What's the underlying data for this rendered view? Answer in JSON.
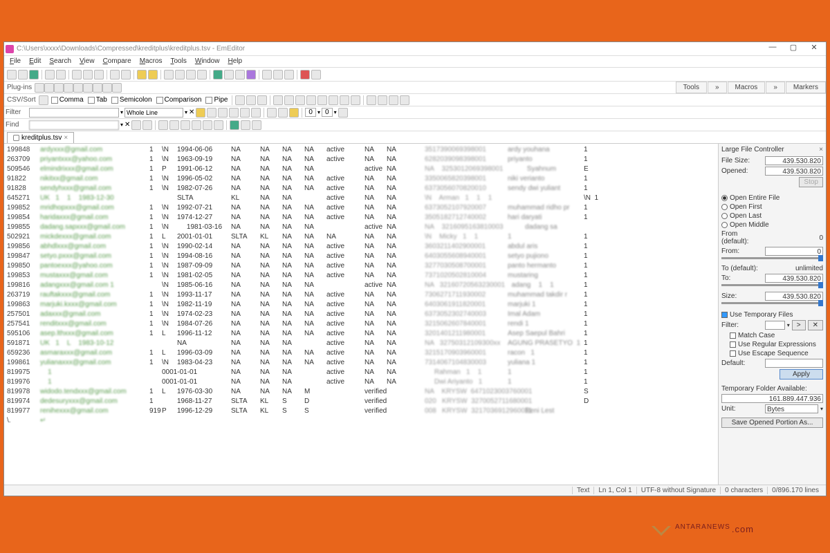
{
  "window": {
    "title": "C:\\Users\\xxxx\\Downloads\\Compressed\\kreditplus\\kreditplus.tsv - EmEditor",
    "min": "—",
    "max": "▢",
    "close": "✕"
  },
  "menu": {
    "file": "File",
    "edit": "Edit",
    "search": "Search",
    "view": "View",
    "compare": "Compare",
    "macros": "Macros",
    "tools": "Tools",
    "window": "Window",
    "help": "Help"
  },
  "plugins": {
    "label": "Plug-ins"
  },
  "sidetabs": {
    "tools": "Tools",
    "macros": "Macros",
    "markers": "Markers",
    "arrow": "»"
  },
  "csvbar": {
    "label": "CSV/Sort",
    "comma": "Comma",
    "tab": "Tab",
    "semicolon": "Semicolon",
    "comparison": "Comparison",
    "pipe": "Pipe"
  },
  "filter": {
    "label": "Filter",
    "mode": "Whole Line",
    "x": "✕"
  },
  "find": {
    "label": "Find"
  },
  "tab": {
    "name": "kreditplus.tsv",
    "close": "×"
  },
  "lfc": {
    "title": "Large File Controller",
    "x": "×",
    "filesize_lbl": "File Size:",
    "filesize": "439.530.820",
    "opened_lbl": "Opened:",
    "opened": "439.530.820",
    "stop": "Stop",
    "open_entire": "Open Entire File",
    "open_first": "Open First",
    "open_last": "Open Last",
    "open_middle": "Open Middle",
    "from_def_lbl": "From (default):",
    "from_def": "0",
    "from_lbl": "From:",
    "from": "0",
    "to_def_lbl": "To (default):",
    "to_def": "unlimited",
    "to_lbl": "To:",
    "to": "439.530.820",
    "size_lbl": "Size:",
    "size": "439.530.820",
    "use_temp": "Use Temporary Files",
    "filter_lbl": "Filter:",
    "match_case": "Match Case",
    "use_regex": "Use Regular Expressions",
    "use_esc": "Use Escape Sequence",
    "default_lbl": "Default:",
    "apply": "Apply",
    "tmp_avail_lbl": "Temporary Folder Available:",
    "tmp_avail": "161.889.447.936",
    "unit_lbl": "Unit:",
    "unit": "Bytes",
    "save_portion": "Save Opened Portion As..."
  },
  "status": {
    "mode": "Text",
    "pos": "Ln 1, Col 1",
    "enc": "UTF-8 without Signature",
    "chars": "0 characters",
    "lines": "0/896.170 lines"
  },
  "watermark": {
    "brand": "ANTARANEWS",
    "suffix": ".com"
  },
  "rows": [
    {
      "id": "199848",
      "em": "ardyxxx@gmail.com",
      "a": "1",
      "b": "\\N",
      "dt": "1994-06-06",
      "e": "NA",
      "f": "NA",
      "g": "NA",
      "h": "NA",
      "st": "active",
      "j": "NA",
      "k": "NA",
      "l": "3517390069398001",
      "nm": "ardy youhana",
      "n": "1"
    },
    {
      "id": "263709",
      "em": "priyantxxx@yahoo.com",
      "a": "1",
      "b": "\\N",
      "dt": "1963-09-19",
      "e": "NA",
      "f": "NA",
      "g": "NA",
      "h": "NA",
      "st": "active",
      "j": "NA",
      "k": "NA",
      "l": "6282039098398001",
      "nm": "priyanto",
      "n": "1"
    },
    {
      "id": "509546",
      "em": "elmindrixxx@gmail.com",
      "a": "1",
      "b": "P",
      "dt": "1991-06-12",
      "e": "NA",
      "f": "NA",
      "g": "NA",
      "h": "NA",
      "st": "",
      "j": "active",
      "k": "NA",
      "l": "NA    3253012069398001",
      "nm": "          Syahnum",
      "n": "E"
    },
    {
      "id": "91822",
      "em": "nikitxx@gmail.com",
      "a": "1",
      "b": "\\N",
      "dt": "1996-05-02",
      "e": "NA",
      "f": "NA",
      "g": "NA",
      "h": "NA",
      "st": "active",
      "j": "NA",
      "k": "NA",
      "l": "3350065820398001",
      "nm": "niki verianto",
      "n": "1"
    },
    {
      "id": "91828",
      "em": "sendyhxxx@gmail.com",
      "a": "1",
      "b": "\\N",
      "dt": "1982-07-26",
      "e": "NA",
      "f": "NA",
      "g": "NA",
      "h": "NA",
      "st": "active",
      "j": "NA",
      "k": "NA",
      "l": "6373056070820010",
      "nm": "sendy dwi yuliant",
      "n": "1"
    },
    {
      "id": "645271",
      "em": "UK   1    1    1983-12-30",
      "a": "",
      "b": "",
      "dt": "SLTA",
      "e": "KL",
      "f": "NA",
      "g": "NA",
      "h": "",
      "st": "active",
      "j": "NA",
      "k": "NA",
      "l": "\\N    Arman   1    1    1",
      "nm": " ",
      "n": "\\N  1"
    },
    {
      "id": "199852",
      "em": "mridhopxxx@gmail.com",
      "a": "1",
      "b": "\\N",
      "dt": "1992-07-21",
      "e": "NA",
      "f": "NA",
      "g": "NA",
      "h": "NA",
      "st": "active",
      "j": "NA",
      "k": "NA",
      "l": "6373052107920007",
      "nm": "muhammad ridho pr",
      "n": "1"
    },
    {
      "id": "199854",
      "em": "haridaxxx@gmail.com",
      "a": "1",
      "b": "\\N",
      "dt": "1974-12-27",
      "e": "NA",
      "f": "NA",
      "g": "NA",
      "h": "NA",
      "st": "active",
      "j": "NA",
      "k": "NA",
      "l": "3505182712740002",
      "nm": "hari daryati",
      "n": "1"
    },
    {
      "id": "199855",
      "em": "dadang.sapxxx@gmail.com",
      "a": "1",
      "b": "\\N",
      "dt": "     1981-03-16",
      "e": "NA",
      "f": "NA",
      "g": "NA",
      "h": "NA",
      "st": "",
      "j": "active",
      "k": "NA",
      "l": "NA    3216095163810003",
      "nm": "         dadang sa",
      "n": ""
    },
    {
      "id": "502921",
      "em": "mickdexxx@gmail.com",
      "a": "1",
      "b": "L",
      "dt": "2001-01-01",
      "e": "SLTA",
      "f": "KL",
      "g": "NA",
      "h": "NA",
      "st": "NA",
      "j": "NA",
      "k": "NA",
      "l": "\\N    Micky   1    1",
      "nm": "1",
      "n": "1"
    },
    {
      "id": "199856",
      "em": "abhdlxxx@gmail.com",
      "a": "1",
      "b": "\\N",
      "dt": "1990-02-14",
      "e": "NA",
      "f": "NA",
      "g": "NA",
      "h": "NA",
      "st": "active",
      "j": "NA",
      "k": "NA",
      "l": "3603211402900001",
      "nm": "abdul aris",
      "n": "1"
    },
    {
      "id": "199847",
      "em": "setyo.pxxx@gmail.com",
      "a": "1",
      "b": "\\N",
      "dt": "1994-08-16",
      "e": "NA",
      "f": "NA",
      "g": "NA",
      "h": "NA",
      "st": "active",
      "j": "NA",
      "k": "NA",
      "l": "6403055608940001",
      "nm": "setyo pujiono",
      "n": "1"
    },
    {
      "id": "199850",
      "em": "pantoexxx@yahoo.com",
      "a": "1",
      "b": "\\N",
      "dt": "1987-09-09",
      "e": "NA",
      "f": "NA",
      "g": "NA",
      "h": "NA",
      "st": "active",
      "j": "NA",
      "k": "NA",
      "l": "3277030508700001",
      "nm": "panto hermanto",
      "n": "1"
    },
    {
      "id": "199853",
      "em": "mustaxxx@gmail.com",
      "a": "1",
      "b": "\\N",
      "dt": "1981-02-05",
      "e": "NA",
      "f": "NA",
      "g": "NA",
      "h": "NA",
      "st": "active",
      "j": "NA",
      "k": "NA",
      "l": "7371020502810004",
      "nm": "mustaring",
      "n": "1"
    },
    {
      "id": "199816",
      "em": "adangxxx@gmail.com 1",
      "a": "",
      "b": "\\N",
      "dt": "1985-06-16",
      "e": "NA",
      "f": "NA",
      "g": "NA",
      "h": "NA",
      "st": "",
      "j": "active",
      "k": "NA",
      "l": "NA   32160720563230001",
      "nm": "  adang    1    1",
      "n": "1"
    },
    {
      "id": "263719",
      "em": "rauftakxxx@gmail.com",
      "a": "1",
      "b": "\\N",
      "dt": "1993-11-17",
      "e": "NA",
      "f": "NA",
      "g": "NA",
      "h": "NA",
      "st": "active",
      "j": "NA",
      "k": "NA",
      "l": "7306271711930002",
      "nm": "muhammad takdir r",
      "n": "1"
    },
    {
      "id": "199863",
      "em": "marjuki.kxxx@gmail.com",
      "a": "1",
      "b": "\\N",
      "dt": "1982-11-19",
      "e": "NA",
      "f": "NA",
      "g": "NA",
      "h": "NA",
      "st": "active",
      "j": "NA",
      "k": "NA",
      "l": "6403061911820001",
      "nm": "marjuki 1",
      "n": "1"
    },
    {
      "id": "257501",
      "em": "adaxxx@gmail.com",
      "a": "1",
      "b": "\\N",
      "dt": "1974-02-23",
      "e": "NA",
      "f": "NA",
      "g": "NA",
      "h": "NA",
      "st": "active",
      "j": "NA",
      "k": "NA",
      "l": "6373052302740003",
      "nm": "Imal Adam",
      "n": "1"
    },
    {
      "id": "257541",
      "em": "renditxxx@gmail.com",
      "a": "1",
      "b": "\\N",
      "dt": "1984-07-26",
      "e": "NA",
      "f": "NA",
      "g": "NA",
      "h": "NA",
      "st": "active",
      "j": "NA",
      "k": "NA",
      "l": "3215062607840001",
      "nm": "rendi 1",
      "n": "1"
    },
    {
      "id": "595106",
      "em": "asep.lthxxx@gmail.com",
      "a": "1",
      "b": "L",
      "dt": "1996-11-12",
      "e": "NA",
      "f": "NA",
      "g": "NA",
      "h": "NA",
      "st": "active",
      "j": "NA",
      "k": "NA",
      "l": "3201401211980001",
      "nm": "Asep Saepul Bahri",
      "n": "1"
    },
    {
      "id": "591871",
      "em": "UK   1    L    1983-10-12",
      "a": "",
      "b": "",
      "dt": "NA",
      "e": "NA",
      "f": "NA",
      "g": "NA",
      "h": "",
      "st": "active",
      "j": "NA",
      "k": "NA",
      "l": "NA   32750312109300xx",
      "nm": "AGUNG PRASETYO  1",
      "n": "1"
    },
    {
      "id": "659236",
      "em": "asmaraxxx@gmail.com",
      "a": "1",
      "b": "L",
      "dt": "1996-03-09",
      "e": "NA",
      "f": "NA",
      "g": "NA",
      "h": "NA",
      "st": "active",
      "j": "NA",
      "k": "NA",
      "l": "3215170903960001",
      "nm": "racon   1",
      "n": "1"
    },
    {
      "id": "199861",
      "em": "yulianaxxx@gmail.com",
      "a": "1",
      "b": "\\N",
      "dt": "1983-04-23",
      "e": "NA",
      "f": "NA",
      "g": "NA",
      "h": "NA",
      "st": "active",
      "j": "NA",
      "k": "NA",
      "l": "7314067104830003",
      "nm": "yuliana 1",
      "n": "1"
    },
    {
      "id": "819975",
      "em": "    1",
      "a": "",
      "b": "0001-01-01",
      "dt": "",
      "e": "NA",
      "f": "NA",
      "g": "NA",
      "h": "",
      "st": "active",
      "j": "NA",
      "k": "NA",
      "l": "     Rahman   1    1",
      "nm": "1",
      "n": "1"
    },
    {
      "id": "819976",
      "em": "    1",
      "a": "",
      "b": "0001-01-01",
      "dt": "",
      "e": "NA",
      "f": "NA",
      "g": "NA",
      "h": "",
      "st": "active",
      "j": "NA",
      "k": "NA",
      "l": "     Dwi Ariyanto   1",
      "nm": "1",
      "n": "1"
    },
    {
      "id": "819978",
      "em": "widodo.tendxxx@gmail.com",
      "a": "1",
      "b": "L",
      "dt": "1976-03-30",
      "e": "NA",
      "f": "NA",
      "g": "NA",
      "h": "M",
      "st": "",
      "j": "verified",
      "k": "",
      "l": "NA    KRYSW  6471023003760001",
      "nm": "",
      "n": "S"
    },
    {
      "id": "819974",
      "em": "dedesuryxxx@gmail.com",
      "a": "1",
      "b": "",
      "dt": "1968-11-27",
      "e": "SLTA",
      "f": "KL",
      "g": "S",
      "h": "D",
      "st": "",
      "j": "verified",
      "k": "",
      "l": "020   KRYSW  3270052711680001",
      "nm": "",
      "n": "D"
    },
    {
      "id": "819977",
      "em": "renihexxx@gmail.com",
      "a": "919",
      "b": "P",
      "dt": "1996-12-29",
      "e": "SLTA",
      "f": "KL",
      "g": "S",
      "h": "S",
      "st": "",
      "j": "verified",
      "k": "",
      "l": "008   KRYSW  3217036912960011",
      "nm": "         Reni Lest",
      "n": ""
    },
    {
      "id": "\\.",
      "em": "↵",
      "a": "",
      "b": "",
      "dt": "",
      "e": "",
      "f": "",
      "g": "",
      "h": "",
      "st": "",
      "j": "",
      "k": "",
      "l": "",
      "nm": "",
      "n": ""
    }
  ]
}
